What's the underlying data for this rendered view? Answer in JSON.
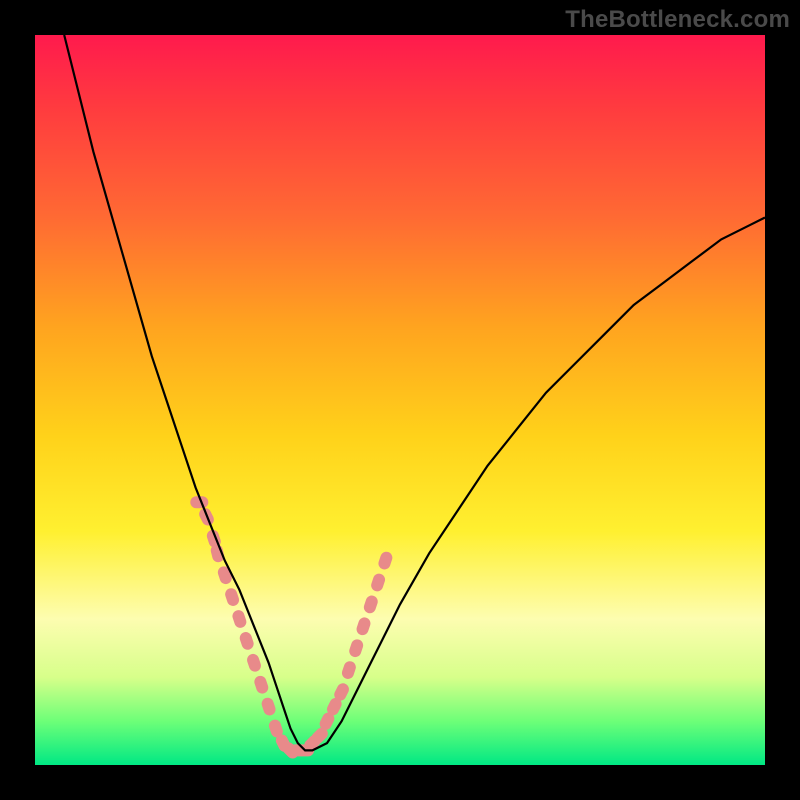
{
  "watermark": "TheBottleneck.com",
  "chart_data": {
    "type": "line",
    "title": "",
    "xlabel": "",
    "ylabel": "",
    "xlim": [
      0,
      100
    ],
    "ylim": [
      0,
      100
    ],
    "grid": false,
    "legend": false,
    "series": [
      {
        "name": "curve",
        "color": "#000000",
        "x": [
          4,
          6,
          8,
          10,
          12,
          14,
          16,
          18,
          20,
          22,
          24,
          26,
          28,
          30,
          32,
          33,
          34,
          35,
          36,
          37,
          38,
          40,
          42,
          44,
          46,
          48,
          50,
          54,
          58,
          62,
          66,
          70,
          74,
          78,
          82,
          86,
          90,
          94,
          98,
          100
        ],
        "y": [
          100,
          92,
          84,
          77,
          70,
          63,
          56,
          50,
          44,
          38,
          33,
          28,
          24,
          19,
          14,
          11,
          8,
          5,
          3,
          2,
          2,
          3,
          6,
          10,
          14,
          18,
          22,
          29,
          35,
          41,
          46,
          51,
          55,
          59,
          63,
          66,
          69,
          72,
          74,
          75
        ]
      }
    ],
    "marker_segments": [
      {
        "shape": "beads",
        "color": "#e88a8a",
        "x": [
          22.5,
          23.5,
          24.5,
          25.0,
          26.0,
          27.0,
          28.0,
          29.0,
          30.0,
          31.0,
          32.0,
          33.0,
          34.0,
          35.0,
          36.0,
          37.0,
          38.0,
          39.0,
          40.0,
          41.0,
          42.0,
          43.0,
          44.0,
          45.0,
          46.0,
          47.0,
          48.0
        ],
        "y": [
          36,
          34,
          31,
          29,
          26,
          23,
          20,
          17,
          14,
          11,
          8,
          5,
          3,
          2,
          2,
          2,
          3,
          4,
          6,
          8,
          10,
          13,
          16,
          19,
          22,
          25,
          28
        ]
      }
    ],
    "background_gradient": {
      "top": "#ff1a4d",
      "bottom": "#00e884"
    }
  }
}
